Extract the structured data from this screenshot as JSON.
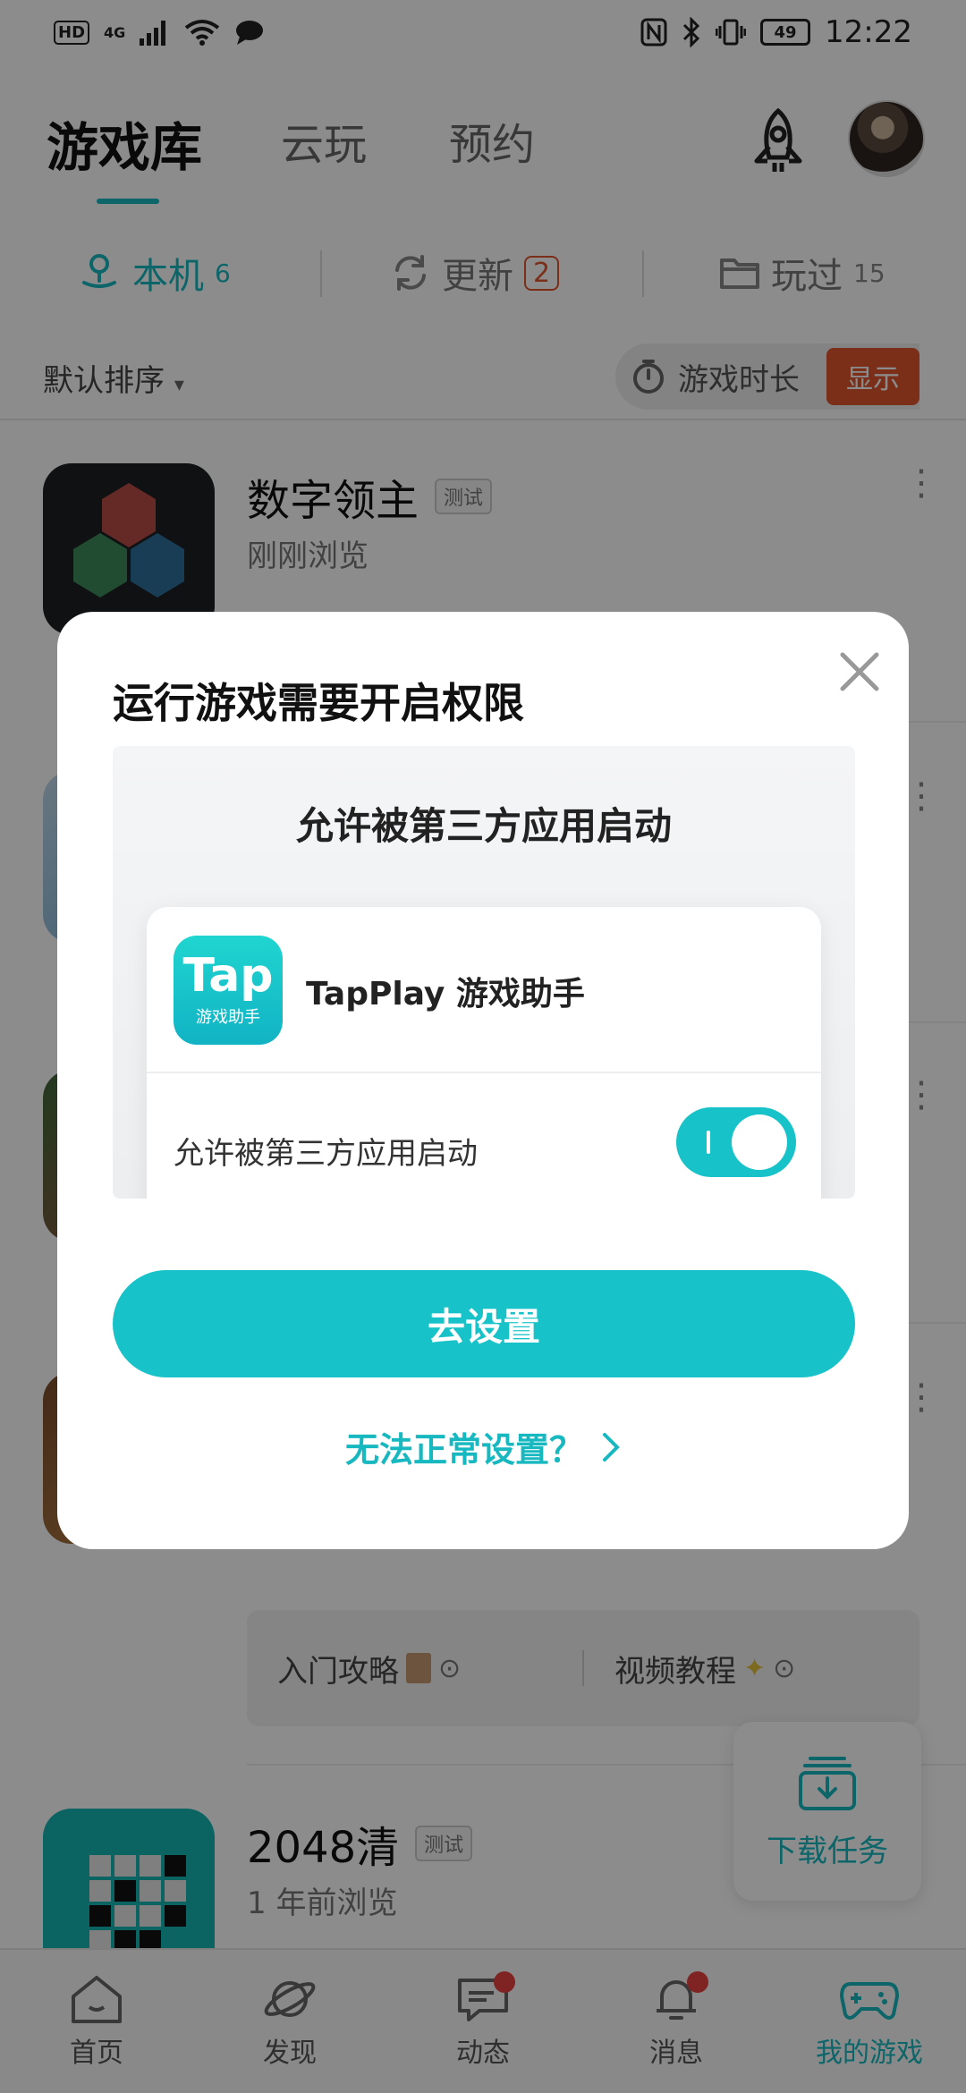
{
  "status_bar": {
    "hd": "HD",
    "network": "4G",
    "battery": "49",
    "time": "12:22"
  },
  "header": {
    "tabs": [
      {
        "label": "游戏库",
        "active": true
      },
      {
        "label": "云玩",
        "active": false
      },
      {
        "label": "预约",
        "active": false
      }
    ]
  },
  "sub_tabs": [
    {
      "label": "本机",
      "count": "6",
      "active": true
    },
    {
      "label": "更新",
      "count": "2",
      "active": false
    },
    {
      "label": "玩过",
      "count": "15",
      "active": false
    }
  ],
  "sort": {
    "label": "默认排序",
    "playtime_label": "游戏时长",
    "show_label": "显示"
  },
  "games": [
    {
      "title": "数字领主",
      "tag": "测试",
      "subtitle": "刚刚浏览"
    },
    {
      "title": "2048清",
      "tag": "测试",
      "subtitle": "1 年前浏览"
    }
  ],
  "guide": {
    "beginner": "入门攻略",
    "video": "视频教程"
  },
  "download_fab": {
    "label": "下载任务"
  },
  "bottom_nav": [
    {
      "label": "首页",
      "icon": "home-icon",
      "dot": false,
      "active": false
    },
    {
      "label": "发现",
      "icon": "planet-icon",
      "dot": false,
      "active": false
    },
    {
      "label": "动态",
      "icon": "chat-icon",
      "dot": true,
      "active": false
    },
    {
      "label": "消息",
      "icon": "bell-icon",
      "dot": true,
      "active": false
    },
    {
      "label": "我的游戏",
      "icon": "gamepad-icon",
      "dot": false,
      "active": true
    }
  ],
  "dialog": {
    "title": "运行游戏需要开启权限",
    "illustration_title": "允许被第三方应用启动",
    "app_logo_text": "Tap",
    "app_logo_subtext": "游戏助手",
    "app_name": "TapPlay 游戏助手",
    "permission_label": "允许被第三方应用启动",
    "primary_button": "去设置",
    "help_link": "无法正常设置？"
  },
  "colors": {
    "accent": "#17b8c0",
    "badge": "#e0552d",
    "notification_dot": "#e84141"
  }
}
